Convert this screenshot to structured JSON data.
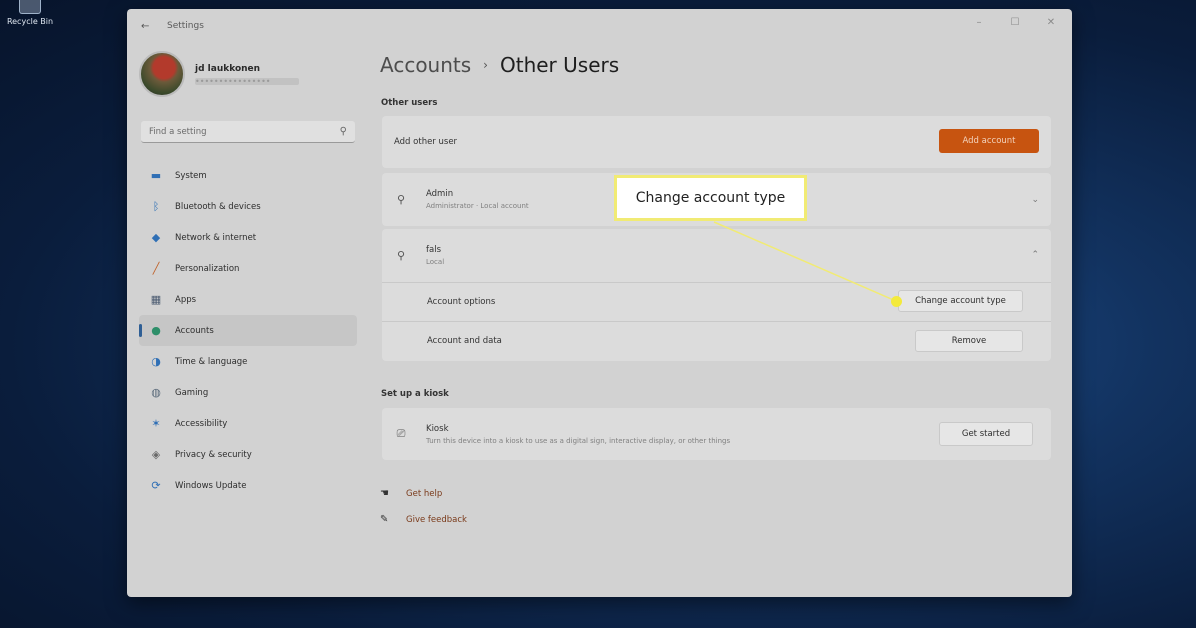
{
  "desktop": {
    "recycle_bin_label": "Recycle Bin"
  },
  "window": {
    "app_title": "Settings",
    "back_icon": "back-arrow-icon",
    "controls": [
      "minimize-icon",
      "maximize-icon",
      "close-icon"
    ]
  },
  "profile": {
    "name": "jd laukkonen",
    "email": "••••••••••••••••"
  },
  "search": {
    "placeholder": "Find a setting"
  },
  "sidebar": {
    "items": [
      {
        "label": "System",
        "icon": "monitor-icon",
        "color": "#2f6fb5",
        "active": false
      },
      {
        "label": "Bluetooth & devices",
        "icon": "bluetooth-icon",
        "color": "#2f6fb5",
        "active": false
      },
      {
        "label": "Network & internet",
        "icon": "wifi-icon",
        "color": "#2f6fb5",
        "active": false
      },
      {
        "label": "Personalization",
        "icon": "brush-icon",
        "color": "#c0632b",
        "active": false
      },
      {
        "label": "Apps",
        "icon": "apps-icon",
        "color": "#4a5a70",
        "active": false
      },
      {
        "label": "Accounts",
        "icon": "person-icon",
        "color": "#2e8f6a",
        "active": true
      },
      {
        "label": "Time & language",
        "icon": "globe-clock-icon",
        "color": "#2f6fb5",
        "active": false
      },
      {
        "label": "Gaming",
        "icon": "gamepad-icon",
        "color": "#5a6a7a",
        "active": false
      },
      {
        "label": "Accessibility",
        "icon": "accessibility-icon",
        "color": "#2f6fb5",
        "active": false
      },
      {
        "label": "Privacy & security",
        "icon": "shield-icon",
        "color": "#6a6a6a",
        "active": false
      },
      {
        "label": "Windows Update",
        "icon": "update-icon",
        "color": "#2f6fb5",
        "active": false
      }
    ]
  },
  "breadcrumb": {
    "parent": "Accounts",
    "separator": "›",
    "current": "Other Users"
  },
  "other_users": {
    "section_title": "Other users",
    "add_row_label": "Add other user",
    "add_button": "Add account",
    "users": [
      {
        "name": "Admin",
        "subtitle": "Administrator · Local account",
        "expanded": false
      },
      {
        "name": "fals",
        "subtitle": "Local",
        "expanded": true
      }
    ],
    "account_options_label": "Account options",
    "change_type_button": "Change account type",
    "account_data_label": "Account and data",
    "remove_button": "Remove"
  },
  "kiosk": {
    "section_title": "Set up a kiosk",
    "title": "Kiosk",
    "description": "Turn this device into a kiosk to use as a digital sign, interactive display, or other things",
    "button": "Get started"
  },
  "help": {
    "get_help": "Get help",
    "give_feedback": "Give feedback"
  },
  "callout": {
    "text": "Change account type",
    "color": "#f1eb74"
  }
}
